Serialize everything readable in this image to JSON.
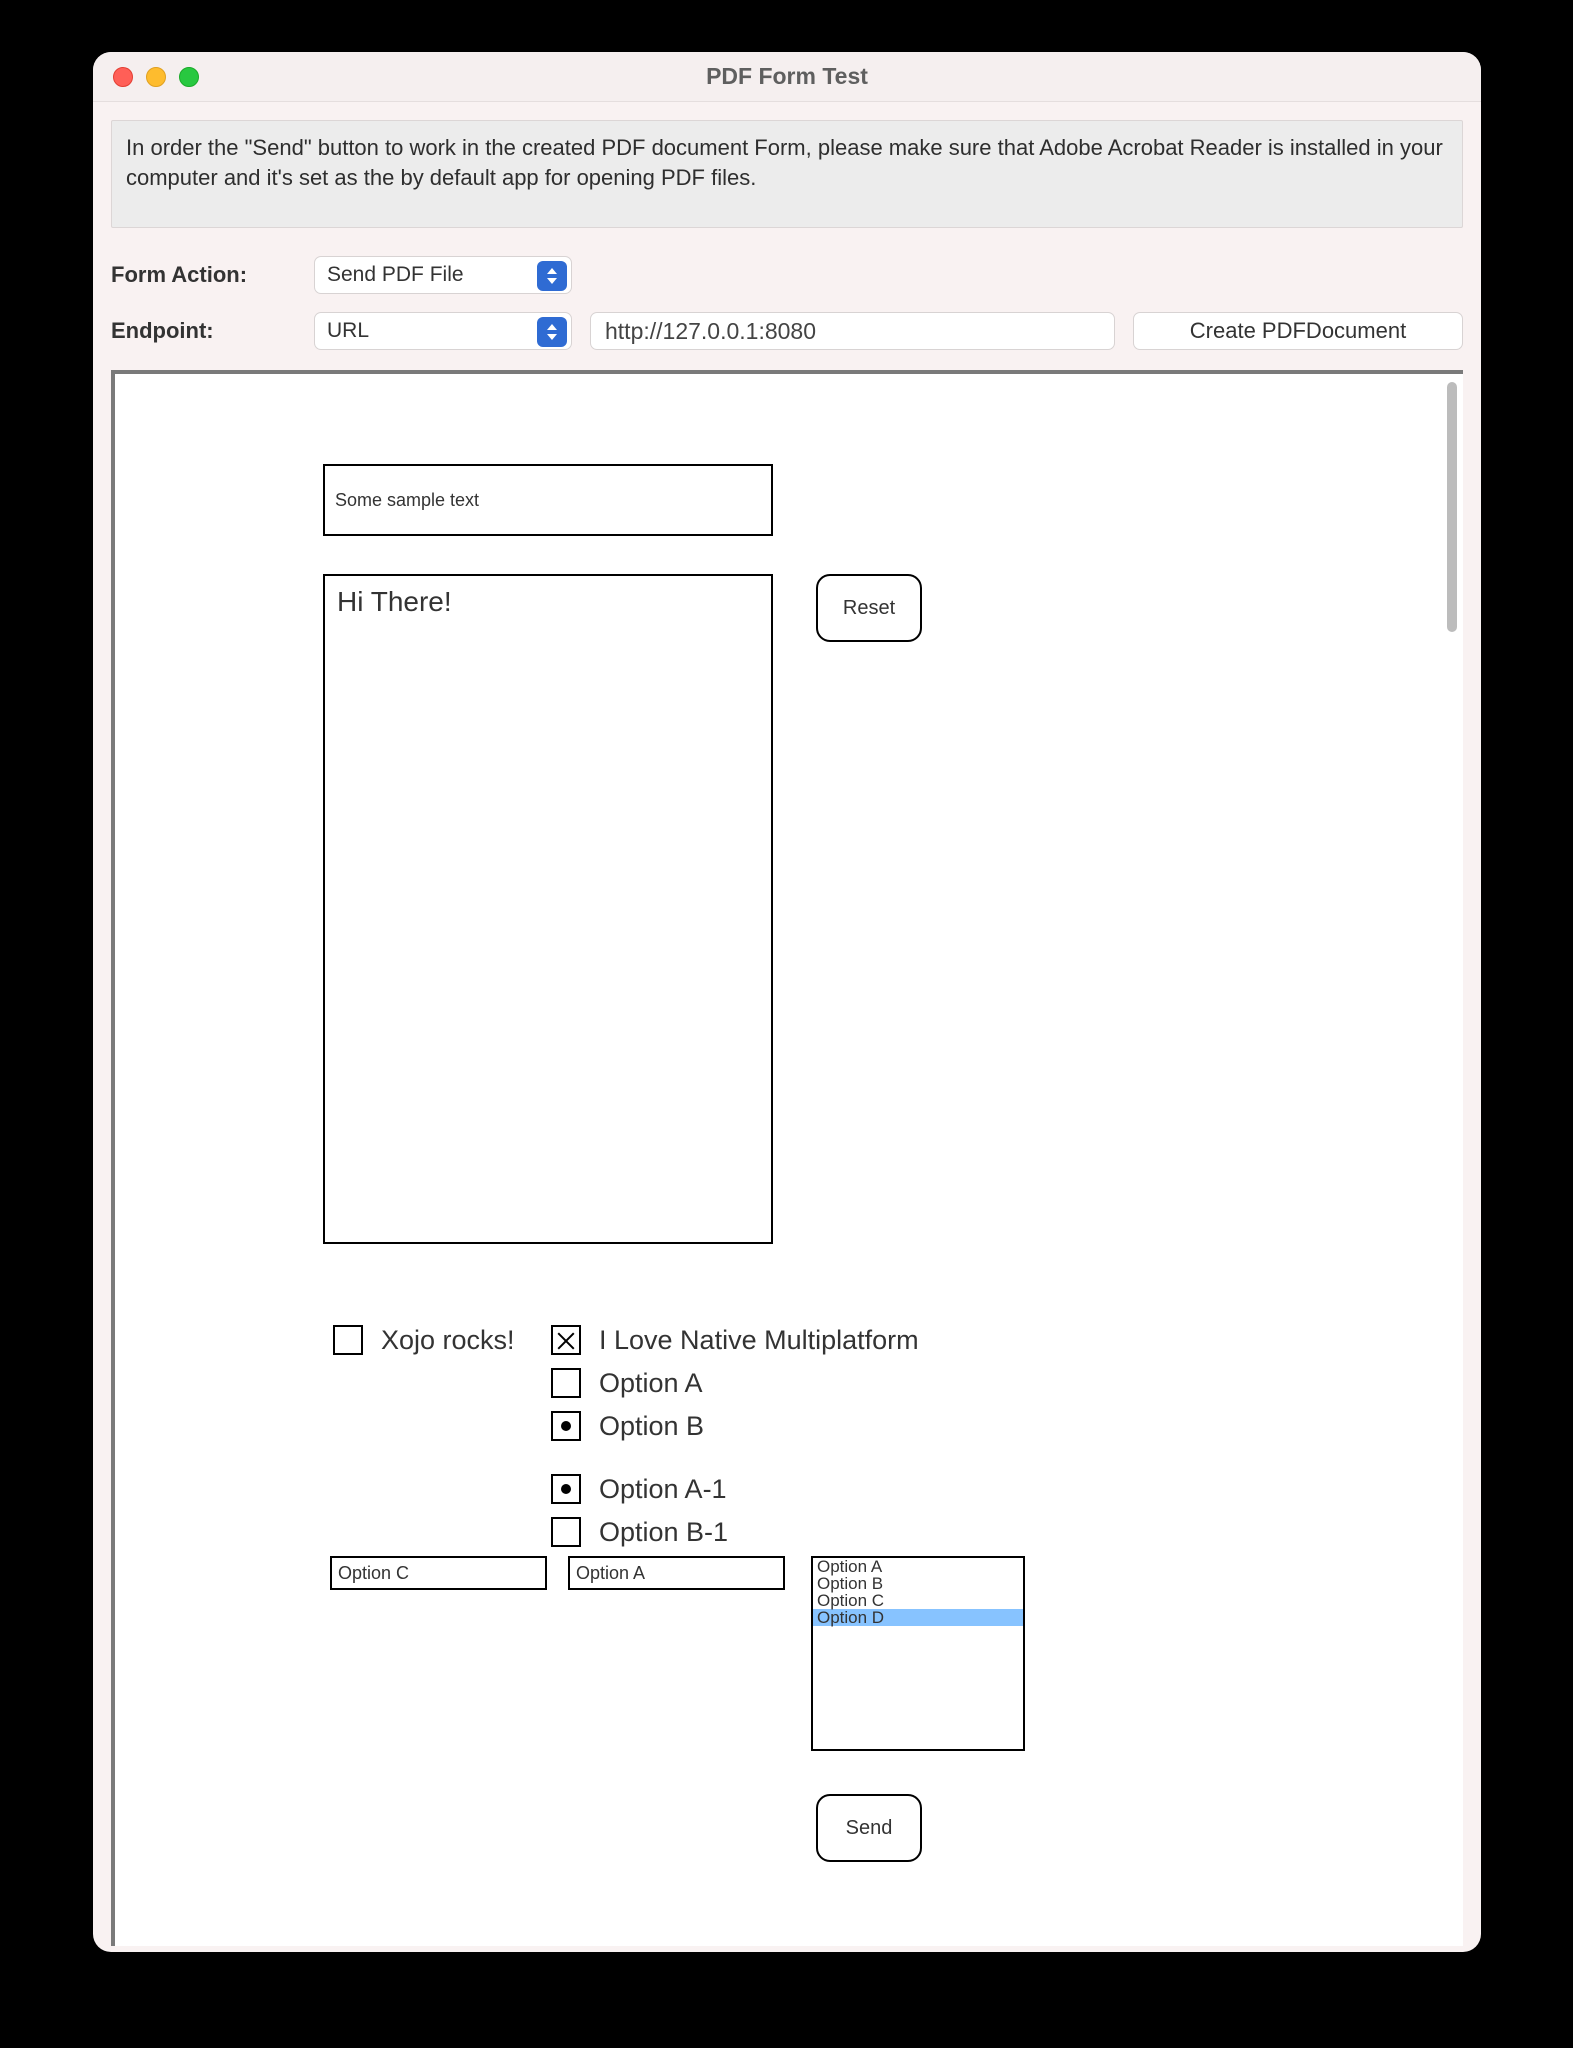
{
  "window": {
    "title": "PDF Form Test"
  },
  "info": {
    "text": "In order the \"Send\" button to work in the created PDF document Form, please make sure that Adobe Acrobat Reader is installed in your computer and it's set as the by default app for opening PDF files."
  },
  "formAction": {
    "label": "Form Action:",
    "value": "Send PDF File"
  },
  "endpoint": {
    "label": "Endpoint:",
    "typeValue": "URL",
    "urlValue": "http://127.0.0.1:8080"
  },
  "createButton": {
    "label": "Create PDFDocument"
  },
  "doc": {
    "sampleText": "Some sample text",
    "bigText": "Hi There!",
    "resetLabel": "Reset",
    "sendLabel": "Send",
    "checkbox1": {
      "label": "Xojo rocks!",
      "checked": false
    },
    "checkbox2": {
      "label": "I Love Native Multiplatform",
      "checked": true
    },
    "radioGroup1": {
      "optionA": {
        "label": "Option A",
        "checked": false
      },
      "optionB": {
        "label": "Option B",
        "checked": true
      }
    },
    "radioGroup2": {
      "optionA1": {
        "label": "Option A-1",
        "checked": true
      },
      "optionB1": {
        "label": "Option B-1",
        "checked": false
      }
    },
    "comboLeft": {
      "value": "Option C"
    },
    "comboRight": {
      "value": "Option A"
    },
    "listbox": {
      "options": [
        "Option A",
        "Option B",
        "Option C",
        "Option D"
      ],
      "selected": "Option D"
    }
  }
}
